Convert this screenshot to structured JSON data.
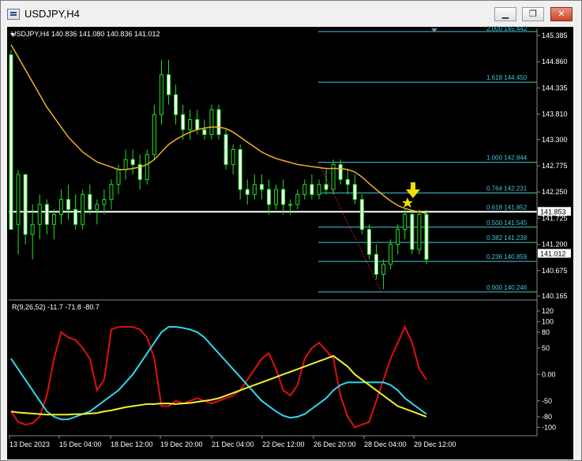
{
  "window": {
    "title": "USDJPY,H4",
    "minimize_icon": "minimize-icon",
    "restore_icon": "restore-icon",
    "close_icon": "close-icon"
  },
  "chart": {
    "header": "USDJPY,H4  140.836 141.080 140.836 141.012",
    "price_axis": [
      "145.385",
      "144.860",
      "144.335",
      "143.810",
      "143.300",
      "142.775",
      "142.250",
      "141.725",
      "141.200",
      "140.675",
      "140.165"
    ],
    "current_price": "141.012",
    "hline_price": "141.853",
    "fib_levels": [
      {
        "label": "1.618  144.450",
        "price": 144.45
      },
      {
        "label": "1.000  142.844",
        "price": 142.844
      },
      {
        "label": "0.764  142.231",
        "price": 142.231
      },
      {
        "label": "0.618  141.852",
        "price": 141.852
      },
      {
        "label": "0.500  141.545",
        "price": 141.545
      },
      {
        "label": "0.382  141.238",
        "price": 141.238
      },
      {
        "label": "0.236  140.859",
        "price": 140.859
      },
      {
        "label": "0.000  140.246",
        "price": 140.246
      }
    ],
    "fib_top_label": "2.000  145.442",
    "arrow_icon": "down-arrow-icon",
    "star_icon": "star-icon"
  },
  "indicator": {
    "header": "R(9,26,52) -11.7 -71.8 -80.7",
    "axis": [
      "120",
      "100",
      "80",
      "50",
      "0.00",
      "-50",
      "-80",
      "-100"
    ]
  },
  "time_axis": [
    "13 Dec 2023",
    "15 Dec 04:00",
    "18 Dec 12:00",
    "19 Dec 20:00",
    "21 Dec 04:00",
    "22 Dec 12:00",
    "26 Dec 20:00",
    "28 Dec 04:00",
    "29 Dec 12:00"
  ],
  "chart_data": {
    "type": "candlestick",
    "symbol": "USDJPY",
    "timeframe": "H4",
    "ylim": [
      140.165,
      145.5
    ],
    "candles": [
      [
        145.0,
        145.1,
        141.6,
        141.5
      ],
      [
        141.6,
        142.7,
        141.0,
        142.6
      ],
      [
        142.6,
        142.6,
        141.2,
        141.4
      ],
      [
        141.4,
        142.0,
        140.9,
        141.6
      ],
      [
        141.6,
        142.2,
        141.3,
        142.0
      ],
      [
        142.0,
        142.1,
        141.4,
        141.6
      ],
      [
        141.6,
        141.9,
        141.3,
        141.8
      ],
      [
        141.8,
        142.3,
        141.6,
        142.1
      ],
      [
        142.1,
        142.4,
        141.7,
        141.9
      ],
      [
        141.9,
        142.2,
        141.5,
        141.6
      ],
      [
        141.6,
        142.3,
        141.5,
        142.2
      ],
      [
        142.2,
        142.4,
        141.8,
        141.9
      ],
      [
        141.9,
        142.1,
        141.6,
        142.0
      ],
      [
        142.0,
        142.3,
        141.8,
        142.1
      ],
      [
        142.1,
        142.5,
        141.9,
        142.4
      ],
      [
        142.4,
        142.8,
        142.2,
        142.7
      ],
      [
        142.7,
        143.1,
        142.5,
        142.9
      ],
      [
        142.9,
        143.1,
        142.6,
        142.8
      ],
      [
        142.8,
        143.0,
        142.3,
        142.5
      ],
      [
        142.5,
        143.1,
        142.4,
        143.0
      ],
      [
        143.0,
        144.0,
        142.9,
        143.8
      ],
      [
        143.8,
        144.9,
        143.6,
        144.6
      ],
      [
        144.6,
        144.9,
        144.0,
        144.2
      ],
      [
        144.2,
        144.4,
        143.6,
        143.8
      ],
      [
        143.8,
        144.0,
        143.3,
        143.5
      ],
      [
        143.5,
        143.9,
        143.3,
        143.7
      ],
      [
        143.7,
        143.9,
        143.4,
        143.5
      ],
      [
        143.5,
        143.7,
        143.3,
        143.4
      ],
      [
        143.4,
        144.0,
        143.3,
        143.9
      ],
      [
        143.9,
        144.0,
        143.3,
        143.4
      ],
      [
        143.4,
        143.5,
        142.7,
        142.8
      ],
      [
        142.8,
        143.2,
        142.6,
        143.1
      ],
      [
        143.1,
        143.2,
        142.1,
        142.3
      ],
      [
        142.3,
        142.5,
        142.0,
        142.2
      ],
      [
        142.2,
        142.6,
        142.1,
        142.4
      ],
      [
        142.4,
        142.6,
        142.1,
        142.3
      ],
      [
        142.3,
        142.5,
        141.8,
        142.0
      ],
      [
        142.0,
        142.4,
        141.9,
        142.3
      ],
      [
        142.3,
        142.5,
        141.8,
        142.0
      ],
      [
        142.0,
        142.1,
        141.8,
        142.0
      ],
      [
        142.0,
        142.3,
        141.9,
        142.2
      ],
      [
        142.2,
        142.5,
        142.1,
        142.4
      ],
      [
        142.4,
        142.6,
        142.1,
        142.2
      ],
      [
        142.2,
        142.5,
        142.1,
        142.4
      ],
      [
        142.4,
        142.7,
        142.2,
        142.3
      ],
      [
        142.3,
        142.9,
        142.2,
        142.8
      ],
      [
        142.8,
        142.9,
        142.4,
        142.5
      ],
      [
        142.5,
        142.7,
        142.2,
        142.4
      ],
      [
        142.4,
        142.6,
        142.0,
        142.1
      ],
      [
        142.1,
        142.2,
        141.4,
        141.5
      ],
      [
        141.5,
        141.6,
        140.9,
        141.0
      ],
      [
        141.0,
        141.2,
        140.5,
        140.6
      ],
      [
        140.6,
        140.9,
        140.3,
        140.8
      ],
      [
        140.8,
        141.3,
        140.7,
        141.2
      ],
      [
        141.2,
        141.6,
        141.0,
        141.5
      ],
      [
        141.5,
        141.9,
        141.3,
        141.8
      ],
      [
        141.8,
        141.9,
        141.0,
        141.1
      ],
      [
        141.1,
        141.9,
        141.0,
        141.8
      ],
      [
        141.8,
        141.9,
        140.8,
        140.9
      ]
    ],
    "ma": [
      145.2,
      144.95,
      144.7,
      144.45,
      144.2,
      143.95,
      143.75,
      143.55,
      143.35,
      143.2,
      143.05,
      142.95,
      142.85,
      142.8,
      142.75,
      142.7,
      142.7,
      142.72,
      142.75,
      142.8,
      142.9,
      143.05,
      143.2,
      143.3,
      143.38,
      143.45,
      143.5,
      143.53,
      143.55,
      143.55,
      143.52,
      143.45,
      143.35,
      143.25,
      143.15,
      143.05,
      142.98,
      142.92,
      142.88,
      142.84,
      142.8,
      142.78,
      142.76,
      142.74,
      142.72,
      142.72,
      142.72,
      142.7,
      142.65,
      142.55,
      142.42,
      142.3,
      142.18,
      142.07,
      141.98,
      141.92,
      141.88,
      141.85,
      141.82
    ],
    "indicator": {
      "name": "R(9,26,52)",
      "values_shown": [
        -11.7,
        -71.8,
        -80.7
      ],
      "ylim": [
        -110,
        125
      ],
      "series": [
        {
          "color": "#e01010",
          "values": [
            -70,
            -90,
            -95,
            -92,
            -80,
            -40,
            30,
            80,
            70,
            65,
            50,
            30,
            -30,
            -10,
            85,
            90,
            90,
            90,
            85,
            70,
            30,
            -60,
            -60,
            -50,
            -55,
            -50,
            -45,
            -50,
            -55,
            -50,
            -45,
            -40,
            -30,
            -10,
            10,
            30,
            40,
            10,
            -30,
            -40,
            -20,
            30,
            50,
            60,
            45,
            30,
            -40,
            -80,
            -100,
            -95,
            -90,
            -50,
            -10,
            30,
            60,
            90,
            60,
            10,
            -10
          ]
        },
        {
          "color": "#30d8f0",
          "values": [
            30,
            10,
            -10,
            -30,
            -50,
            -70,
            -80,
            -85,
            -85,
            -80,
            -75,
            -70,
            -60,
            -50,
            -40,
            -30,
            -15,
            0,
            20,
            40,
            60,
            80,
            90,
            90,
            88,
            85,
            80,
            70,
            55,
            40,
            25,
            10,
            -5,
            -20,
            -35,
            -50,
            -60,
            -70,
            -78,
            -82,
            -80,
            -75,
            -65,
            -55,
            -45,
            -30,
            -20,
            -15,
            -15,
            -15,
            -15,
            -15,
            -15,
            -20,
            -30,
            -45,
            -55,
            -65,
            -75
          ]
        },
        {
          "color": "#f0f030",
          "values": [
            -70,
            -72,
            -73,
            -74,
            -75,
            -76,
            -76,
            -76,
            -76,
            -75,
            -75,
            -74,
            -73,
            -70,
            -68,
            -65,
            -62,
            -60,
            -58,
            -56,
            -56,
            -55,
            -55,
            -56,
            -55,
            -54,
            -52,
            -50,
            -48,
            -45,
            -40,
            -35,
            -30,
            -25,
            -20,
            -15,
            -10,
            -5,
            0,
            5,
            10,
            15,
            20,
            25,
            30,
            35,
            25,
            15,
            0,
            -10,
            -20,
            -30,
            -40,
            -50,
            -60,
            -65,
            -70,
            -75,
            -80
          ]
        }
      ]
    }
  }
}
